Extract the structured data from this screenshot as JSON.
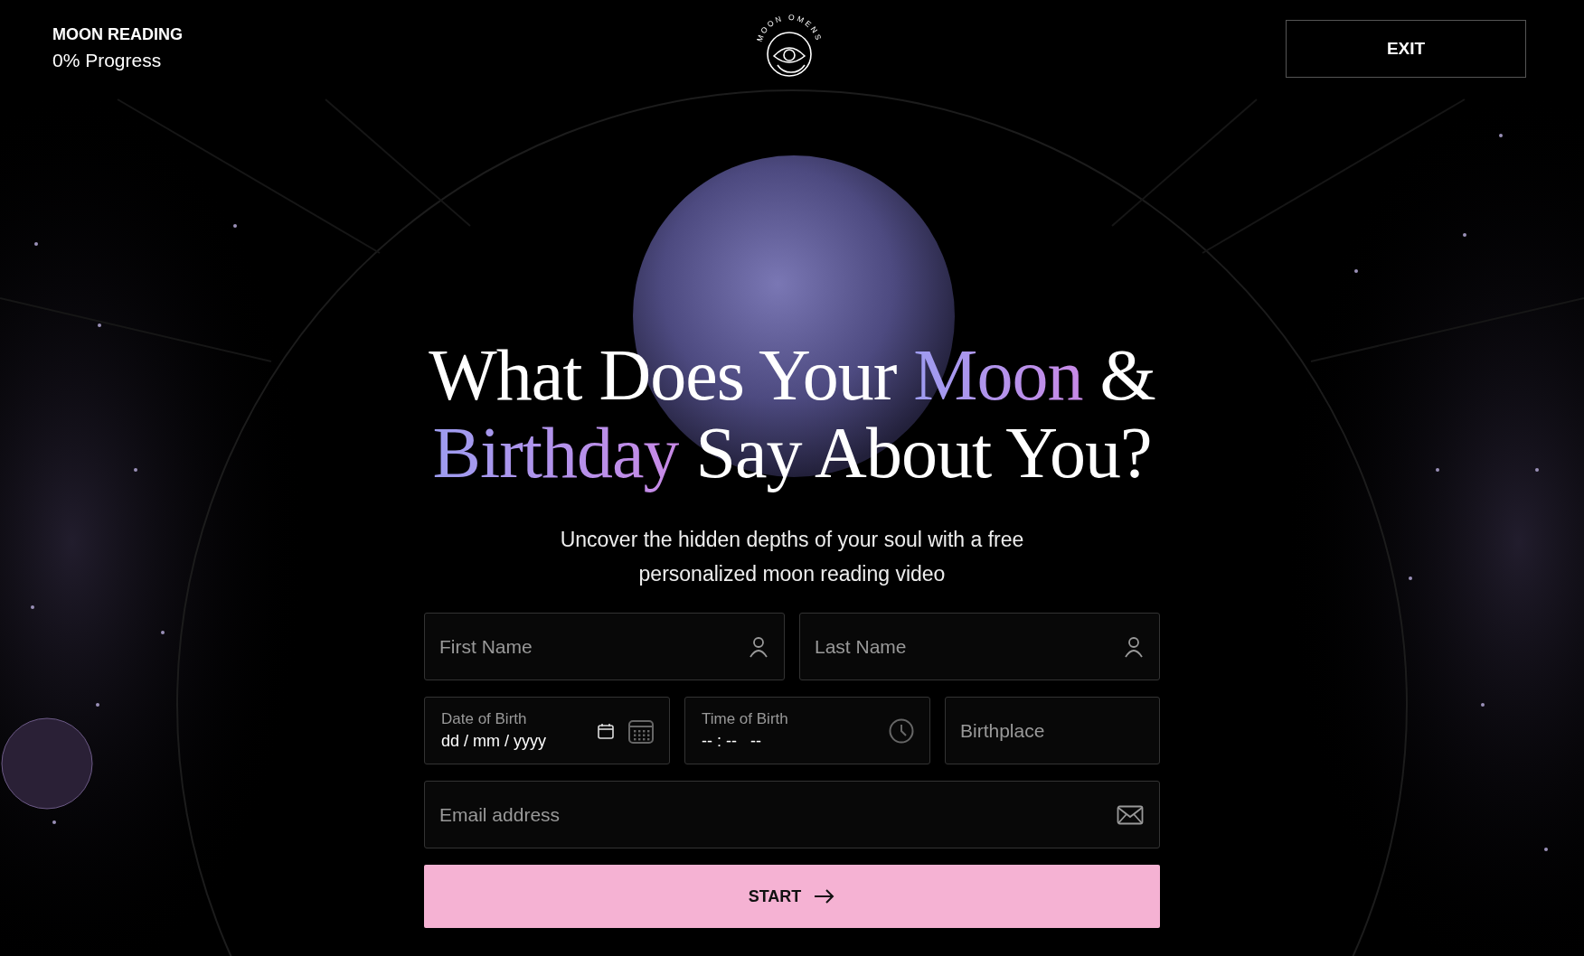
{
  "header": {
    "title": "MOON READING",
    "progress": "0% Progress",
    "logo_text": "MOON OMENS",
    "exit_button": "EXIT"
  },
  "heading": {
    "lines": [
      [
        {
          "text": "What Does Your ",
          "accent": false
        },
        {
          "text": "Moon",
          "accent": true
        },
        {
          "text": " &",
          "accent": false
        }
      ],
      [
        {
          "text": "Birthday",
          "accent": true
        },
        {
          "text": " Say About You?",
          "accent": false
        }
      ]
    ]
  },
  "subtitle": "Uncover the hidden depths of your soul with a free personalized moon reading video",
  "form": {
    "rows": [
      [
        {
          "kind": "name",
          "placeholder": "First Name"
        },
        {
          "kind": "name",
          "placeholder": "Last Name"
        }
      ],
      [
        {
          "kind": "date",
          "label": "Date of Birth",
          "placeholder": "dd / mm / yyyy"
        },
        {
          "kind": "time",
          "label": "Time of Birth",
          "placeholder": "-- : --   --"
        },
        {
          "kind": "place",
          "placeholder": "Birthplace"
        }
      ],
      [
        {
          "kind": "email",
          "placeholder": "Email address"
        }
      ]
    ],
    "start_button": "START"
  }
}
